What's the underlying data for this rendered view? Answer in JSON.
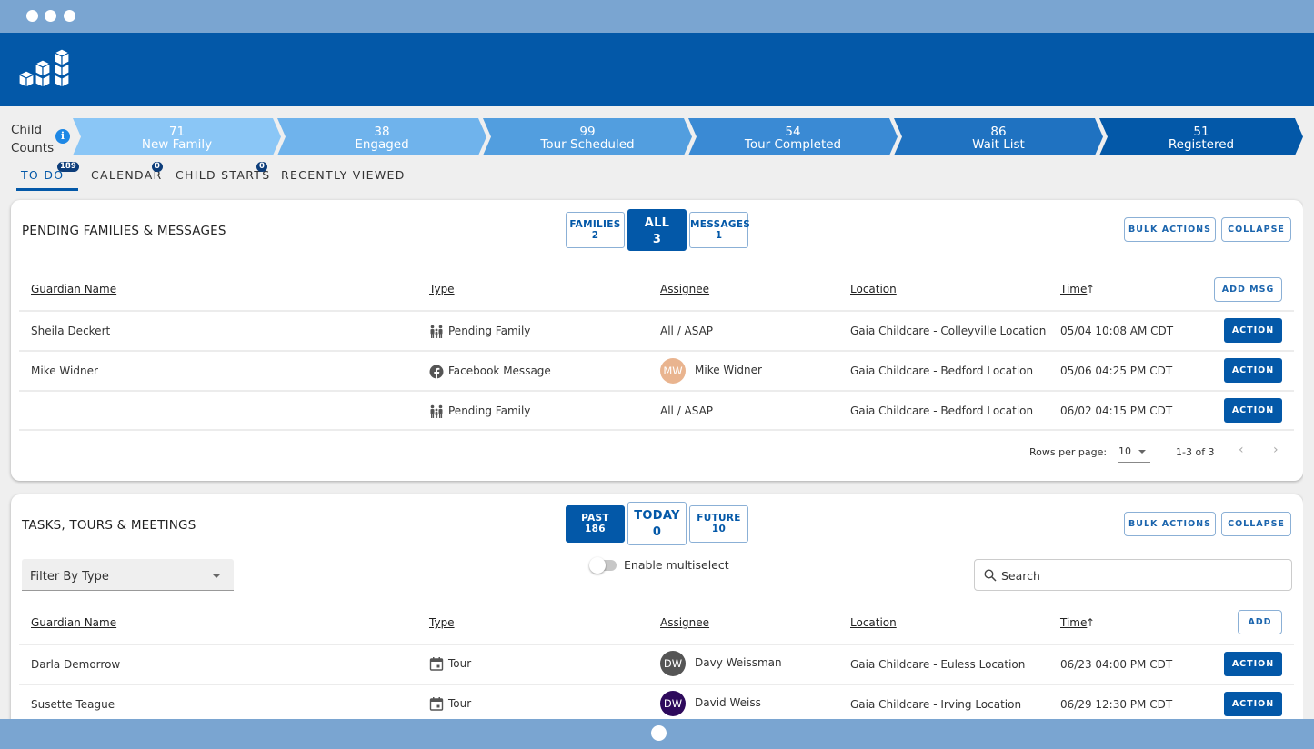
{
  "window": {
    "controls": [
      "close",
      "minimize",
      "maximize"
    ]
  },
  "appbar": {
    "logo_icon": "cubes-logo-icon",
    "color": "#0358a8"
  },
  "counts": {
    "label_line1": "Child",
    "label_line2": "Counts",
    "info_icon": "i",
    "stages": [
      {
        "count": "71",
        "label": "New Family",
        "color": "#8ac6f6"
      },
      {
        "count": "38",
        "label": "Engaged",
        "color": "#6fb3ec"
      },
      {
        "count": "99",
        "label": "Tour Scheduled",
        "color": "#529edf"
      },
      {
        "count": "54",
        "label": "Tour Completed",
        "color": "#3a8ad4"
      },
      {
        "count": "86",
        "label": "Wait List",
        "color": "#1f72c1"
      },
      {
        "count": "51",
        "label": "Registered",
        "color": "#0358a8"
      }
    ]
  },
  "tabs": [
    {
      "label": "TO DO",
      "badge": "189",
      "active": true
    },
    {
      "label": "CALENDAR",
      "badge": "0"
    },
    {
      "label": "CHILD STARTS",
      "badge": "0"
    },
    {
      "label": "RECENTLY VIEWED"
    }
  ],
  "pending": {
    "title": "PENDING FAMILIES & MESSAGES",
    "filters": [
      {
        "label": "FAMILIES",
        "count": "2"
      },
      {
        "label": "ALL",
        "count": "3",
        "active": true
      },
      {
        "label": "MESSAGES",
        "count": "1"
      }
    ],
    "bulk_actions": "BULK ACTIONS",
    "collapse": "COLLAPSE",
    "add_button": "ADD MSG",
    "columns": [
      "Guardian Name",
      "Type",
      "Assignee",
      "Location",
      "Time"
    ],
    "sort_indicator": "↑",
    "rows": [
      {
        "guardian": "Sheila Deckert",
        "type": "Pending Family",
        "type_icon": "family-icon",
        "assignee": "All / ASAP",
        "location": "Gaia Childcare - Colleyville Location",
        "time": "05/04 10:08 AM CDT",
        "action": "ACTION"
      },
      {
        "guardian": "Mike Widner",
        "type": "Facebook Message",
        "type_icon": "facebook-icon",
        "assignee": "Mike Widner",
        "avatar_initials": "MW",
        "avatar_color": "#e9b48f",
        "location": "Gaia Childcare - Bedford Location",
        "time": "05/06 04:25 PM CDT",
        "action": "ACTION"
      },
      {
        "guardian": "",
        "type": "Pending Family",
        "type_icon": "family-icon",
        "assignee": "All / ASAP",
        "location": "Gaia Childcare - Bedford Location",
        "time": "06/02 04:15 PM CDT",
        "action": "ACTION"
      }
    ],
    "pagination": {
      "rows_per_page_label": "Rows per page:",
      "rows_per_page": "10",
      "range": "1-3 of 3",
      "prev": "‹",
      "next": "›"
    }
  },
  "tasks": {
    "title": "TASKS, TOURS & MEETINGS",
    "filters": [
      {
        "label": "PAST",
        "count": "186",
        "active": true
      },
      {
        "label": "TODAY",
        "count": "0"
      },
      {
        "label": "FUTURE",
        "count": "10"
      }
    ],
    "bulk_actions": "BULK ACTIONS",
    "collapse": "COLLAPSE",
    "filter_by_type": "Filter By Type",
    "multiselect_label": "Enable multiselect",
    "multiselect_enabled": false,
    "search_placeholder": "Search",
    "add_button": "ADD",
    "columns": [
      "Guardian Name",
      "Type",
      "Assignee",
      "Location",
      "Time"
    ],
    "sort_indicator": "↑",
    "rows": [
      {
        "guardian": "Darla Demorrow",
        "type": "Tour",
        "type_icon": "calendar-icon",
        "assignee": "Davy Weissman",
        "avatar_initials": "DW",
        "avatar_color": "#555555",
        "location": "Gaia Childcare - Euless Location",
        "time": "06/23 04:00 PM CDT",
        "action": "ACTION"
      },
      {
        "guardian": "Susette Teague",
        "type": "Tour",
        "type_icon": "calendar-icon",
        "assignee": "David Weiss",
        "avatar_initials": "DW",
        "avatar_color": "#2e0a5c",
        "location": "Gaia Childcare - Irving Location",
        "time": "06/29 12:30 PM CDT",
        "action": "ACTION"
      }
    ]
  }
}
